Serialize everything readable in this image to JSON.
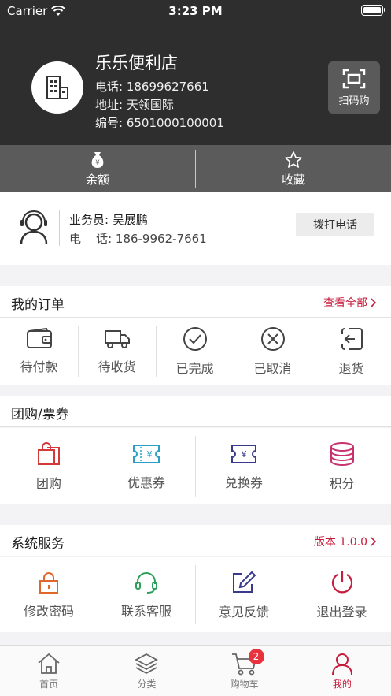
{
  "status_bar": {
    "carrier": "Carrier",
    "time": "3:23 PM"
  },
  "store": {
    "name": "乐乐便利店",
    "phone": "电话: 18699627661",
    "address": "地址: 天领国际",
    "number": "编号: 6501000100001",
    "scan_label": "扫码购"
  },
  "balance_bar": {
    "balance_label": "余额",
    "favorites_label": "收藏"
  },
  "salesman": {
    "name": "业务员: 吴展鹏",
    "phone": "电    话: 186-9962-7661",
    "call_button": "拨打电话"
  },
  "orders": {
    "title": "我的订单",
    "link": "查看全部",
    "items": [
      {
        "label": "待付款",
        "icon": "wallet-icon"
      },
      {
        "label": "待收货",
        "icon": "truck-icon"
      },
      {
        "label": "已完成",
        "icon": "check-circle-icon"
      },
      {
        "label": "已取消",
        "icon": "x-circle-icon"
      },
      {
        "label": "退货",
        "icon": "return-icon"
      }
    ]
  },
  "group": {
    "title": "团购/票券",
    "items": [
      {
        "label": "团购",
        "icon": "shopping-bag-icon"
      },
      {
        "label": "优惠券",
        "icon": "coupon-icon"
      },
      {
        "label": "兑换券",
        "icon": "voucher-icon"
      },
      {
        "label": "积分",
        "icon": "coins-icon"
      }
    ]
  },
  "system": {
    "title": "系统服务",
    "link": "版本 1.0.0",
    "items": [
      {
        "label": "修改密码",
        "icon": "lock-icon"
      },
      {
        "label": "联系客服",
        "icon": "headset-icon"
      },
      {
        "label": "意见反馈",
        "icon": "edit-icon"
      },
      {
        "label": "退出登录",
        "icon": "power-icon"
      }
    ]
  },
  "tabbar": {
    "items": [
      {
        "label": "首页",
        "icon": "home-icon"
      },
      {
        "label": "分类",
        "icon": "layers-icon"
      },
      {
        "label": "购物车",
        "icon": "cart-icon",
        "badge": "2"
      },
      {
        "label": "我的",
        "icon": "user-icon",
        "active": true
      }
    ]
  },
  "colors": {
    "accent": "#c71d3c",
    "header_bg": "#2e2e2e",
    "balance_bar_bg": "#5b5b5b"
  }
}
